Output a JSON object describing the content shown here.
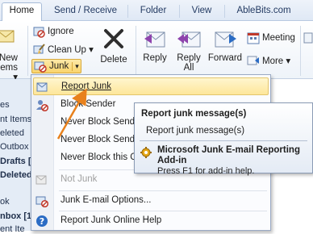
{
  "tabs": [
    {
      "label": "Home",
      "active": true
    },
    {
      "label": "Send / Receive",
      "active": false
    },
    {
      "label": "Folder",
      "active": false
    },
    {
      "label": "View",
      "active": false
    },
    {
      "label": "AbleBits.com",
      "active": false
    }
  ],
  "ribbon": {
    "new_items_partial": "New\nems ▾",
    "ignore_label": "Ignore",
    "cleanup_label": "Clean Up ▾",
    "junk_label": "Junk",
    "delete_label": "Delete",
    "reply_label": "Reply",
    "reply_all_label": "Reply\nAll",
    "forward_label": "Forward",
    "meeting_label": "Meeting",
    "more_label": "More ▾"
  },
  "nav_pane": {
    "items": [
      "es",
      "nt Items",
      "eleted",
      "Outbox",
      "Drafts [2]",
      "Deleted I",
      "ok",
      "nbox [19",
      "ent Ite"
    ]
  },
  "junk_menu": {
    "items": [
      {
        "label": "Report Junk",
        "icon": "report-junk-icon",
        "highlighted": true,
        "disabled": false
      },
      {
        "label": "Block Sender",
        "icon": "block-sender-icon",
        "highlighted": false,
        "disabled": false
      },
      {
        "label": "Never Block Sender",
        "icon": "",
        "highlighted": false,
        "disabled": false
      },
      {
        "label": "Never Block Sender's Domain",
        "icon": "",
        "highlighted": false,
        "disabled": false
      },
      {
        "label": "Never Block this Group",
        "icon": "",
        "highlighted": false,
        "disabled": false
      },
      {
        "label": "Not Junk",
        "icon": "not-junk-icon",
        "highlighted": false,
        "disabled": true
      },
      {
        "label": "Junk E-mail Options...",
        "icon": "junk-options-icon",
        "highlighted": false,
        "disabled": false
      },
      {
        "label": "Report Junk Online Help",
        "icon": "help-icon",
        "highlighted": false,
        "disabled": false
      }
    ]
  },
  "tooltip": {
    "title": "Report junk message(s)",
    "description": "Report junk message(s)",
    "addin_title": "Microsoft Junk E-mail Reporting Add-in",
    "help_text": "Press F1 for add-in help."
  },
  "colors": {
    "accent": "#2b579a",
    "highlight": "#fde69a",
    "arrow": "#e8811c"
  }
}
